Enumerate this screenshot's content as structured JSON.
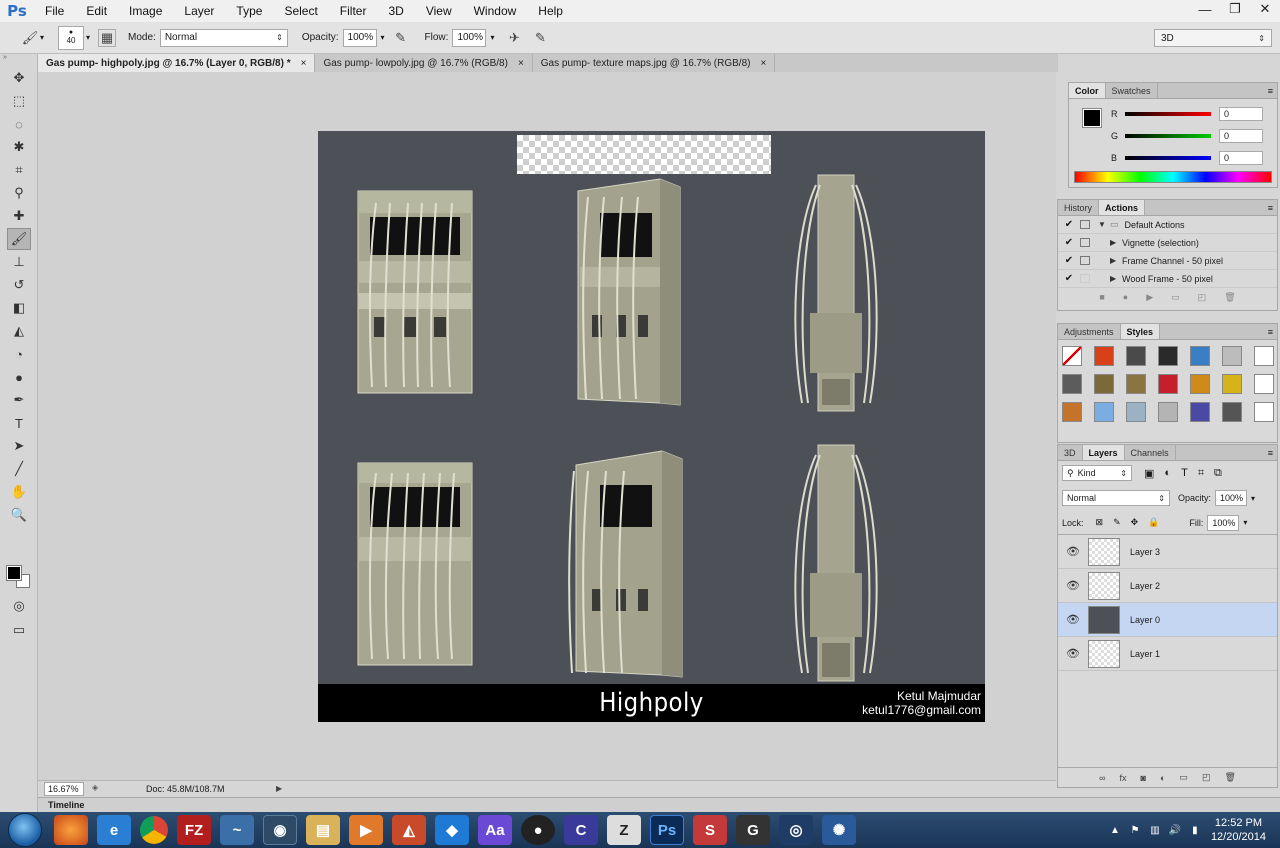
{
  "app": {
    "logo": "Ps",
    "menu": [
      "File",
      "Edit",
      "Image",
      "Layer",
      "Type",
      "Select",
      "Filter",
      "3D",
      "View",
      "Window",
      "Help"
    ],
    "window_controls": [
      "—",
      "❐",
      "✕"
    ]
  },
  "options_bar": {
    "brush_size": "40",
    "mode_label": "Mode:",
    "mode_value": "Normal",
    "opacity_label": "Opacity:",
    "opacity_value": "100%",
    "flow_label": "Flow:",
    "flow_value": "100%",
    "workspace": "3D"
  },
  "document_tabs": [
    {
      "label": "Gas pump- highpoly.jpg @ 16.7% (Layer 0, RGB/8) *",
      "active": true
    },
    {
      "label": "Gas pump- lowpoly.jpg @ 16.7% (RGB/8)",
      "active": false
    },
    {
      "label": "Gas pump- texture maps.jpg @ 16.7% (RGB/8)",
      "active": false
    }
  ],
  "canvas": {
    "caption_title": "Highpoly",
    "author_name": "Ketul Majmudar",
    "author_email": "ketul1776@gmail.com",
    "background_color": "#4e5057"
  },
  "status": {
    "zoom": "16.67%",
    "doc_size": "Doc: 45.8M/108.7M"
  },
  "timeline_label": "Timeline",
  "color_panel": {
    "tabs": [
      "Color",
      "Swatches"
    ],
    "r_label": "R",
    "r": "0",
    "g_label": "G",
    "g": "0",
    "b_label": "B",
    "b": "0"
  },
  "history_panel": {
    "tabs": [
      "History",
      "Actions"
    ],
    "items": [
      "Default Actions",
      "Vignette (selection)",
      "Frame Channel - 50 pixel",
      "Wood Frame - 50 pixel"
    ]
  },
  "adjustments_panel": {
    "tabs": [
      "Adjustments",
      "Styles"
    ],
    "style_colors": [
      "#ffffff",
      "#d8401a",
      "#4a4a4a",
      "#2a2a2a",
      "#3a7fc4",
      "#bcbcbc",
      "#ffffff",
      "#5c5c5c",
      "#7a6a3a",
      "#8a7440",
      "#c41f2a",
      "#d08a1a",
      "#d4b41a",
      "#ffffff",
      "#c4742a",
      "#7aaee2",
      "#9ab2c4",
      "#b4b4b4",
      "#4a4aa4",
      "#555555",
      "#ffffff"
    ]
  },
  "layers_panel": {
    "tabs": [
      "3D",
      "Layers",
      "Channels"
    ],
    "kind_label": "Kind",
    "blend_mode": "Normal",
    "opacity_label": "Opacity:",
    "opacity_value": "100%",
    "lock_label": "Lock:",
    "fill_label": "Fill:",
    "fill_value": "100%",
    "layers": [
      {
        "name": "Layer 3",
        "selected": false
      },
      {
        "name": "Layer 2",
        "selected": false
      },
      {
        "name": "Layer 0",
        "selected": true
      },
      {
        "name": "Layer 1",
        "selected": false
      }
    ]
  },
  "taskbar": {
    "time": "12:52 PM",
    "date": "12/20/2014"
  }
}
